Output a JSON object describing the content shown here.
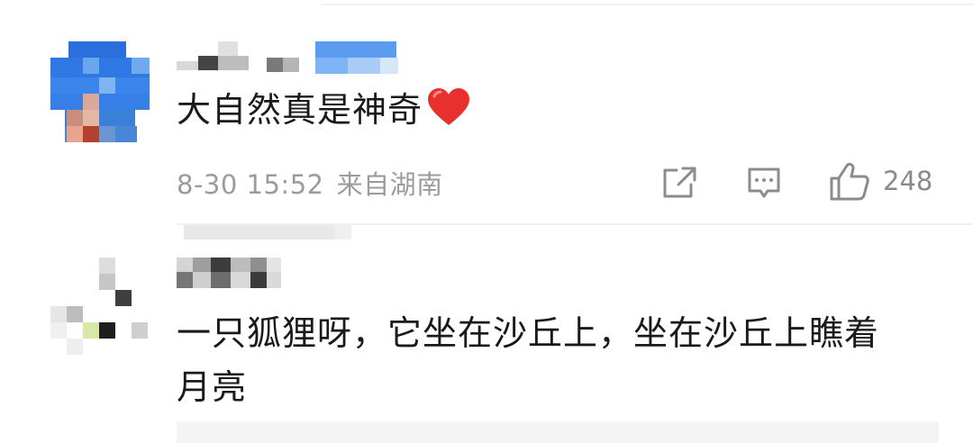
{
  "comments": [
    {
      "text": "大自然真是神奇",
      "emoji": "heart-icon",
      "date": "8-30 15:52",
      "location": "来自湖南",
      "likes": "248"
    },
    {
      "text_line1": "一只狐狸呀，它坐在沙丘上，坐在沙丘上瞧着",
      "text_line2": "月亮"
    }
  ],
  "icons": {
    "share": "share-icon",
    "reply": "comment-icon",
    "like": "thumbs-up-icon"
  },
  "colors": {
    "heart": "#e8302e",
    "meta_text": "#9b9b9b",
    "icon_stroke": "#8c8c8c"
  }
}
